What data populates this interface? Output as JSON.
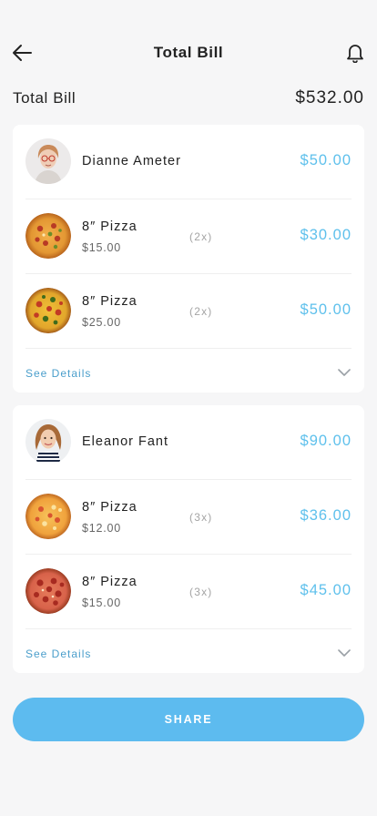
{
  "header": {
    "title": "Total Bill"
  },
  "total": {
    "label": "Total Bill",
    "amount": "$532.00"
  },
  "people": [
    {
      "name": "Dianne Ameter",
      "total": "$50.00",
      "items": [
        {
          "name": "8″ Pizza",
          "price": "$15.00",
          "qty": "(2x)",
          "total": "$30.00"
        },
        {
          "name": "8″ Pizza",
          "price": "$25.00",
          "qty": "(2x)",
          "total": "$50.00"
        }
      ],
      "details_label": "See Details"
    },
    {
      "name": "Eleanor Fant",
      "total": "$90.00",
      "items": [
        {
          "name": "8″ Pizza",
          "price": "$12.00",
          "qty": "(3x)",
          "total": "$36.00"
        },
        {
          "name": "8″ Pizza",
          "price": "$15.00",
          "qty": "(3x)",
          "total": "$45.00"
        }
      ],
      "details_label": "See Details"
    }
  ],
  "share_label": "SHARE",
  "colors": {
    "accent": "#5ec0ec",
    "button": "#5dbbef",
    "link": "#4a9ecb",
    "background": "#f6f6f7"
  },
  "icons": {
    "back": "arrow-left-icon",
    "notifications": "bell-icon",
    "expand": "chevron-down-icon"
  }
}
